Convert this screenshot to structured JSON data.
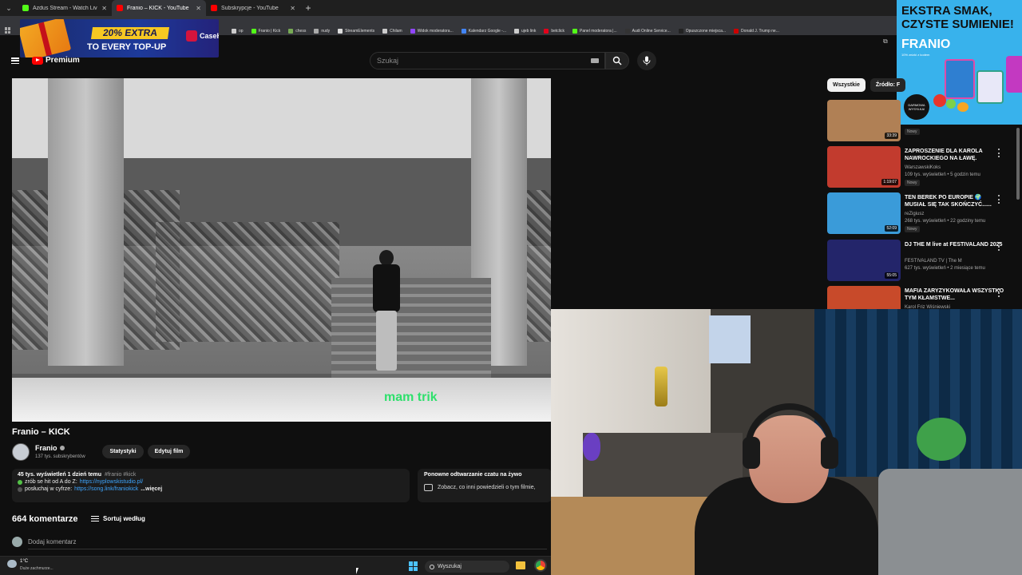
{
  "browser": {
    "tabs": [
      {
        "title": "Azdus Stream - Watch Live on K",
        "favicon_color": "#53fc18",
        "active": false
      },
      {
        "title": "Franio – KICK - YouTube",
        "favicon_color": "#ff0000",
        "active": true
      },
      {
        "title": "Subskrypcje - YouTube",
        "favicon_color": "#ff0000",
        "active": false
      }
    ],
    "bookmarks": [
      {
        "label": "op",
        "color": "#cccccc"
      },
      {
        "label": "Franio | Kick",
        "color": "#53fc18"
      },
      {
        "label": "chess",
        "color": "#77aa55"
      },
      {
        "label": "nudy",
        "color": "#aaaaaa"
      },
      {
        "label": "StreamElements",
        "color": "#dddddd"
      },
      {
        "label": "Chilam",
        "color": "#cccccc"
      },
      {
        "label": "Widok moderatora...",
        "color": "#9146ff"
      },
      {
        "label": "Kalendarz Google -...",
        "color": "#4285f4"
      },
      {
        "label": "ujeb link",
        "color": "#cccccc"
      },
      {
        "label": "betclick",
        "color": "#e2001a"
      },
      {
        "label": "Panel moderatora |...",
        "color": "#53fc18"
      },
      {
        "label": "Audi Online Service...",
        "color": "#333333"
      },
      {
        "label": "Opuszczone miejsca...",
        "color": "#222222"
      },
      {
        "label": "Donald J. Trump ne...",
        "color": "#cc0000"
      }
    ]
  },
  "ads": {
    "casehug": {
      "line1": "20% EXTRA",
      "line2": "TO EVERY TOP-UP",
      "brand": "CaseHug"
    },
    "franio": {
      "line1": "EKSTRA SMAK,",
      "line2": "CZYSTE SUMIENIE!",
      "brand": "FRANIO",
      "sub": "10% znizki z kodem",
      "badge": "DARMOWA WYSYŁKA!"
    }
  },
  "youtube": {
    "logo_text": "Premium",
    "search_placeholder": "Szukaj",
    "video": {
      "title": "Franio – KICK",
      "caption": "mam trik",
      "channel": "Franio",
      "subscribers": "137 tys. subskrybentów",
      "buttons": [
        "Statystyki",
        "Edytuj film"
      ],
      "views_date": "45 tys. wyświetleń  1 dzień temu",
      "tags": "#franio #kick",
      "desc_lines": [
        {
          "text": "zrób se hit od A do Z:",
          "link": "https://nyplowskistudio.pl/",
          "dot": "#53c247"
        },
        {
          "text": "posłuchaj w cyfrze:",
          "link": "https://song.link/franiokick",
          "more": "...więcej",
          "dot": "#555555"
        }
      ],
      "replay_title": "Ponowne odtwarzanie czatu na żywo",
      "replay_desc": "Zobacz, co inni powiedzieli o tym filmie,",
      "comments_count": "664 komentarze",
      "sort_label": "Sortuj według",
      "add_comment": "Dodaj komentarz"
    },
    "chips": [
      "Wszystkie",
      "Źródło: F"
    ],
    "recommendations": [
      {
        "title": "",
        "channel": "",
        "stats": "",
        "duration": "33:39",
        "new": "Nowy",
        "thumb_color": "#b08055"
      },
      {
        "title": "ZAPROSZENIE DLA KAROLA NAWROCKIEGO NA ŁAWĘ.",
        "channel": "WarszawskiKoks",
        "stats": "109 tys. wyświetleń • 5 godzin temu",
        "duration": "1:19:07",
        "new": "Nowy",
        "thumb_color": "#c23b2e"
      },
      {
        "title": "TEN BEREK PO EUROPIE 🌍 MUSIAŁ SIĘ TAK SKOŃCZYĆ......",
        "channel": "reZigiusz",
        "stats": "268 tys. wyświetleń • 22 godziny temu",
        "duration": "52:09",
        "new": "Nowy",
        "thumb_color": "#3a9bd9"
      },
      {
        "title": "DJ THE M live at FESTIVALAND 2025",
        "channel": "FESTIVALAND TV | The M",
        "stats": "627 tys. wyświetleń • 2 miesiące temu",
        "duration": "55:05",
        "new": "",
        "thumb_color": "#23256a"
      },
      {
        "title": "MAFIA ZARYZYKOWAŁA WSZYSTKO TYM KŁAMSTWE...",
        "channel": "Karol Friz Wiśniewski",
        "stats": "",
        "duration": "",
        "new": "",
        "thumb_color": "#c84a2a"
      }
    ]
  },
  "taskbar": {
    "temp": "1°C",
    "weather": "Duże zachmurze...",
    "search": "Wyszukaj"
  }
}
